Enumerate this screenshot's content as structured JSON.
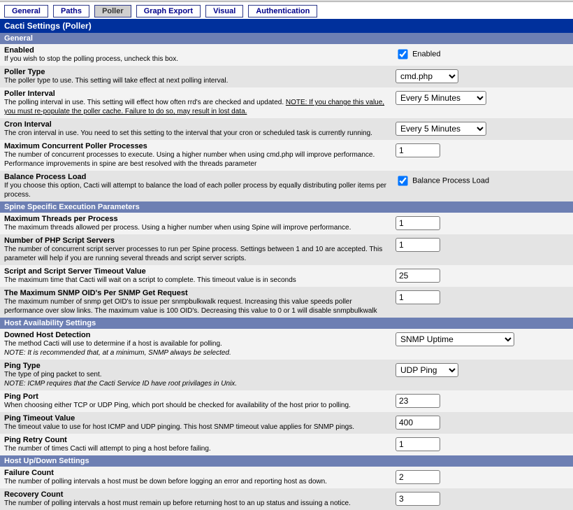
{
  "tabs": {
    "general": "General",
    "paths": "Paths",
    "poller": "Poller",
    "graph_export": "Graph Export",
    "visual": "Visual",
    "authentication": "Authentication"
  },
  "title": "Cacti Settings (Poller)",
  "sections": {
    "general": {
      "header": "General",
      "enabled": {
        "title": "Enabled",
        "desc": "If you wish to stop the polling process, uncheck this box.",
        "cb_label": "Enabled",
        "checked": true
      },
      "poller_type": {
        "title": "Poller Type",
        "desc": "The poller type to use. This setting will take effect at next polling interval.",
        "value": "cmd.php"
      },
      "poller_interval": {
        "title": "Poller Interval",
        "desc_pre": "The polling interval in use. This setting will effect how often rrd's are checked and updated. ",
        "desc_note": "NOTE: If you change this value, you must re-populate the poller cache. Failure to do so, may result in lost data.",
        "value": "Every 5 Minutes"
      },
      "cron_interval": {
        "title": "Cron Interval",
        "desc": "The cron interval in use. You need to set this setting to the interval that your cron or scheduled task is currently running.",
        "value": "Every 5 Minutes"
      },
      "max_concurrent": {
        "title": "Maximum Concurrent Poller Processes",
        "desc": "The number of concurrent processes to execute. Using a higher number when using cmd.php will improve performance. Performance improvements in spine are best resolved with the threads parameter",
        "value": "1"
      },
      "balance_load": {
        "title": "Balance Process Load",
        "desc": "If you choose this option, Cacti will attempt to balance the load of each poller process by equally distributing poller items per process.",
        "cb_label": "Balance Process Load",
        "checked": true
      }
    },
    "spine": {
      "header": "Spine Specific Execution Parameters",
      "max_threads": {
        "title": "Maximum Threads per Process",
        "desc": "The maximum threads allowed per process. Using a higher number when using Spine will improve performance.",
        "value": "1"
      },
      "php_servers": {
        "title": "Number of PHP Script Servers",
        "desc": "The number of concurrent script server processes to run per Spine process. Settings between 1 and 10 are accepted. This parameter will help if you are running several threads and script server scripts.",
        "value": "1"
      },
      "script_timeout": {
        "title": "Script and Script Server Timeout Value",
        "desc": "The maximum time that Cacti will wait on a script to complete. This timeout value is in seconds",
        "value": "25"
      },
      "max_oids": {
        "title": "The Maximum SNMP OID's Per SNMP Get Request",
        "desc": "The maximum number of snmp get OID's to issue per snmpbulkwalk request. Increasing this value speeds poller performance over slow links. The maximum value is 100 OID's. Decreasing this value to 0 or 1 will disable snmpbulkwalk",
        "value": "1"
      }
    },
    "host_avail": {
      "header": "Host Availability Settings",
      "downed_detect": {
        "title": "Downed Host Detection",
        "desc_pre": "The method Cacti will use to determine if a host is available for polling.",
        "desc_note": "NOTE: It is recommended that, at a minimum, SNMP always be selected.",
        "value": "SNMP Uptime"
      },
      "ping_type": {
        "title": "Ping Type",
        "desc_pre": "The type of ping packet to sent.",
        "desc_note": "NOTE: ICMP requires that the Cacti Service ID have root privilages in Unix.",
        "value": "UDP Ping"
      },
      "ping_port": {
        "title": "Ping Port",
        "desc": "When choosing either TCP or UDP Ping, which port should be checked for availability of the host prior to polling.",
        "value": "23"
      },
      "ping_timeout": {
        "title": "Ping Timeout Value",
        "desc": "The timeout value to use for host ICMP and UDP pinging. This host SNMP timeout value applies for SNMP pings.",
        "value": "400"
      },
      "ping_retry": {
        "title": "Ping Retry Count",
        "desc": "The number of times Cacti will attempt to ping a host before failing.",
        "value": "1"
      }
    },
    "host_updown": {
      "header": "Host Up/Down Settings",
      "failure_count": {
        "title": "Failure Count",
        "desc": "The number of polling intervals a host must be down before logging an error and reporting host as down.",
        "value": "2"
      },
      "recovery_count": {
        "title": "Recovery Count",
        "desc": "The number of polling intervals a host must remain up before returning host to an up status and issuing a notice.",
        "value": "3"
      }
    }
  }
}
